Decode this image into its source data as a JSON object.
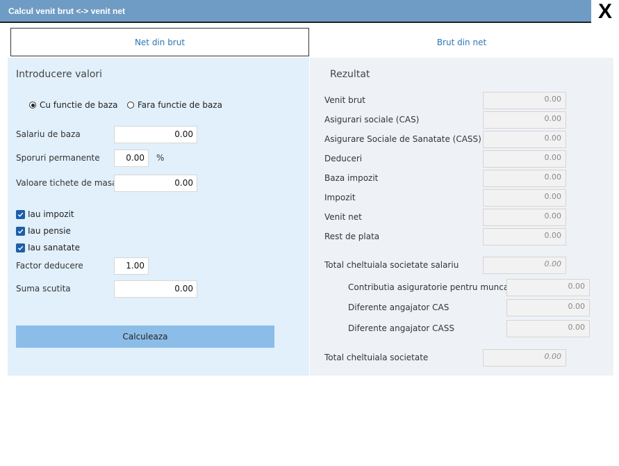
{
  "window": {
    "title": "Calcul venit brut <-> venit net",
    "close_label": "X"
  },
  "tabs": [
    {
      "label": "Net din brut"
    },
    {
      "label": "Brut din net"
    }
  ],
  "input_panel": {
    "title": "Introducere valori",
    "radio": {
      "option1": "Cu functie de baza",
      "option2": "Fara functie de baza",
      "selected": "option1"
    },
    "salariu_label": "Salariu de baza",
    "salariu_value": "0.00",
    "sporuri_label": "Sporuri permanente",
    "sporuri_value": "0.00",
    "sporuri_unit": "%",
    "tichete_label": "Valoare tichete de masa",
    "tichete_value": "0.00",
    "checkboxes": {
      "impozit": "Iau impozit",
      "pensie": "Iau pensie",
      "sanatate": "Iau sanatate"
    },
    "factor_label": "Factor deducere",
    "factor_value": "1.00",
    "suma_label": "Suma scutita",
    "suma_value": "0.00",
    "calc_button": "Calculeaza"
  },
  "result_panel": {
    "title": "Rezultat",
    "rows": [
      {
        "label": "Venit brut",
        "value": "0.00"
      },
      {
        "label": "Asigurari sociale (CAS)",
        "value": "0.00"
      },
      {
        "label": "Asigurare Sociale de Sanatate (CASS)",
        "value": "0.00"
      },
      {
        "label": "Deduceri",
        "value": "0.00"
      },
      {
        "label": "Baza impozit",
        "value": "0.00"
      },
      {
        "label": "Impozit",
        "value": "0.00"
      },
      {
        "label": "Venit net",
        "value": "0.00"
      },
      {
        "label": "Rest de plata",
        "value": "0.00"
      }
    ],
    "total_salariu_label": "Total cheltuiala societate salariu",
    "total_salariu_value": "0.00",
    "sub_rows": [
      {
        "label": "Contributia asiguratorie pentru munca",
        "value": "0.00"
      },
      {
        "label": "Diferente angajator CAS",
        "value": "0.00"
      },
      {
        "label": "Diferente angajator CASS",
        "value": "0.00"
      }
    ],
    "total_label": "Total cheltuiala societate",
    "total_value": "0.00"
  }
}
